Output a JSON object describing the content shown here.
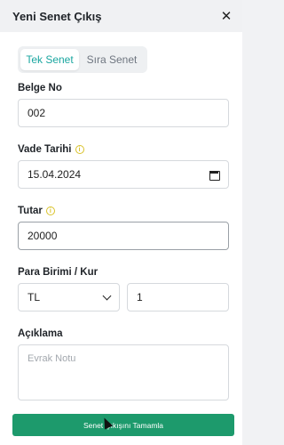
{
  "header": {
    "title": "Yeni Senet Çıkış",
    "close_icon": "close-icon"
  },
  "tabs": [
    {
      "label": "Tek Senet",
      "active": true
    },
    {
      "label": "Sıra Senet",
      "active": false
    }
  ],
  "form": {
    "belge_no": {
      "label": "Belge No",
      "value": "002"
    },
    "vade_tarihi": {
      "label": "Vade Tarihi",
      "value": "15.04.2024",
      "icon": "calendar-icon"
    },
    "tutar": {
      "label": "Tutar",
      "value": "20000"
    },
    "para_birimi": {
      "label": "Para Birimi / Kur",
      "currency": "TL",
      "rate": "1"
    },
    "aciklama": {
      "label": "Açıklama",
      "placeholder": "Evrak Notu"
    }
  },
  "footer": {
    "submit_label": "Senet Çıkışını Tamamla"
  },
  "colors": {
    "accent": "#1aa6a0",
    "button": "#1d9a6c",
    "info_icon": "#d9c22b"
  }
}
